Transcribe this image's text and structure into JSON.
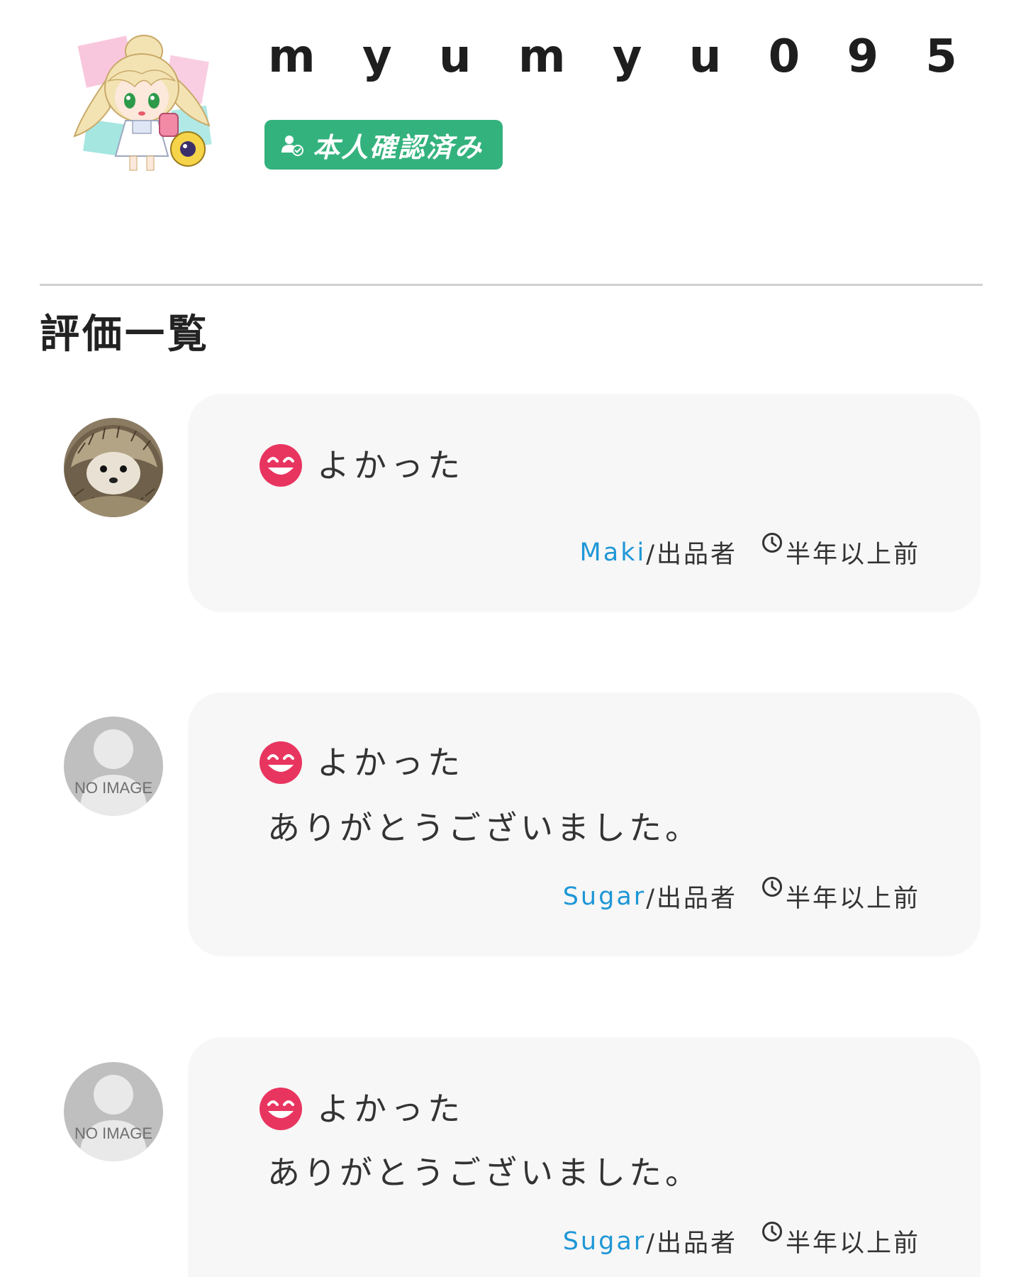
{
  "profile": {
    "username": "m y u m y u 0 9 5",
    "avatar_icon": "anime-character-avatar",
    "verified_badge": {
      "label": "本人確認済み",
      "icon": "verified-user-icon",
      "color": "#34b27d"
    }
  },
  "section_title": "評価一覧",
  "colors": {
    "accent_link": "#1f97d6",
    "rating_smile": "#e8355f",
    "card_background": "#f7f7f7"
  },
  "reviews": [
    {
      "avatar": "hedgehog-photo-avatar",
      "rating_icon": "smile-icon",
      "rating_label": "よかった",
      "comment": "",
      "reviewer_name": "Maki",
      "reviewer_role": "/出品者",
      "time_icon": "clock-icon",
      "time": "半年以上前"
    },
    {
      "avatar": "no-image-avatar",
      "avatar_text": "NO IMAGE",
      "rating_icon": "smile-icon",
      "rating_label": "よかった",
      "comment": "ありがとうございました。",
      "reviewer_name": "Sugar",
      "reviewer_role": "/出品者",
      "time_icon": "clock-icon",
      "time": "半年以上前"
    },
    {
      "avatar": "no-image-avatar",
      "avatar_text": "NO IMAGE",
      "rating_icon": "smile-icon",
      "rating_label": "よかった",
      "comment": "ありがとうございました。",
      "reviewer_name": "Sugar",
      "reviewer_role": "/出品者",
      "time_icon": "clock-icon",
      "time": "半年以上前"
    }
  ]
}
